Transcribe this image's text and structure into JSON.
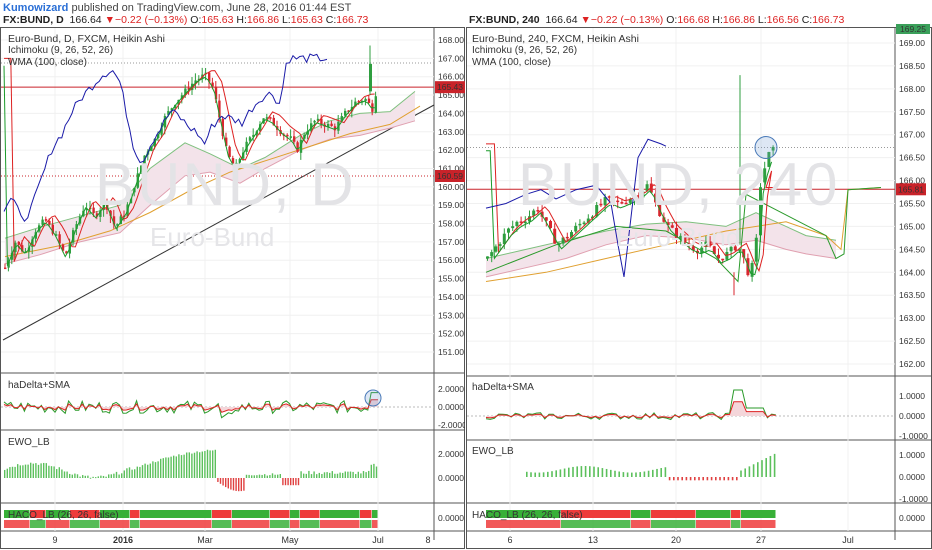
{
  "publish": {
    "author": "Kumowizard",
    "text": " published on TradingView.com, June 28, 2016 01:44 EST"
  },
  "colors": {
    "up": "#2e9e3f",
    "down": "#d8262e",
    "kumo_fill": "#f3e3ea",
    "ma": "#e0a030",
    "kijun": "#d22",
    "tenkan": "#1a9a2a",
    "chikou": "#1a1aa8",
    "leadA": "#2a9a2a",
    "wma": "#1f3a8a"
  },
  "panels": [
    {
      "symbol": "FX:BUND, D",
      "price": "166.64",
      "change": "−0.22 (−0.13%)",
      "ohlc": {
        "o": "165.63",
        "h": "166.86",
        "l": "165.63",
        "c": "166.73"
      },
      "info_line1": "Euro-Bund, D, FXCM, Heikin Ashi",
      "info_line2": "Ichimoku (9, 26, 52, 26)",
      "info_line3": "WMA (100, close)",
      "watermark": "BUND, D",
      "watermark2": "Euro-Bund",
      "y_ticks": [
        "168.00",
        "167.00",
        "166.00",
        "165.00",
        "164.00",
        "163.00",
        "162.00",
        "161.00",
        "160.00",
        "159.00",
        "158.00",
        "157.00",
        "156.00",
        "155.00",
        "154.00",
        "153.00",
        "152.00",
        "151.00"
      ],
      "price_label_1": "165.43",
      "price_label_2": "160.59",
      "x_labels": [
        "9",
        "2016",
        "Mar",
        "May",
        "Jul",
        "8"
      ],
      "sub1": {
        "title": "haDelta+SMA",
        "ticks": [
          "2.0000",
          "0.0000",
          "-2.0000"
        ]
      },
      "sub2": {
        "title": "EWO_LB",
        "ticks": [
          "2.0000",
          "0.0000"
        ]
      },
      "sub3": {
        "title": "HACO_LB (26, 26, false)",
        "ticks": [
          "0.0000"
        ]
      }
    },
    {
      "symbol": "FX:BUND, 240",
      "price": "166.64",
      "change": "−0.22 (−0.13%)",
      "ohlc": {
        "o": "166.68",
        "h": "166.86",
        "l": "166.56",
        "c": "166.73"
      },
      "info_line1": "Euro-Bund, 240, FXCM, Heikin Ashi",
      "info_line2": "Ichimoku (9, 26, 52, 26)",
      "info_line3": "WMA (100, close)",
      "watermark": "BUND, 240",
      "watermark2": "Euro-Bund",
      "y_top_label": "169.25",
      "y_ticks": [
        "169.00",
        "168.50",
        "168.00",
        "167.50",
        "167.00",
        "166.50",
        "166.00",
        "165.50",
        "165.00",
        "164.50",
        "164.00",
        "163.50",
        "163.00",
        "162.50",
        "162.00"
      ],
      "price_label_1": "165.81",
      "x_labels": [
        "6",
        "13",
        "20",
        "27",
        "Jul"
      ],
      "sub1": {
        "title": "haDelta+SMA",
        "ticks": [
          "1.0000",
          "0.0000",
          "-1.0000"
        ]
      },
      "sub2": {
        "title": "EWO_LB",
        "ticks": [
          "1.0000",
          "0.0000",
          "-1.0000"
        ]
      },
      "sub3": {
        "title": "HACO_LB (26, 26, false)",
        "ticks": [
          "0.0000"
        ]
      }
    }
  ]
}
